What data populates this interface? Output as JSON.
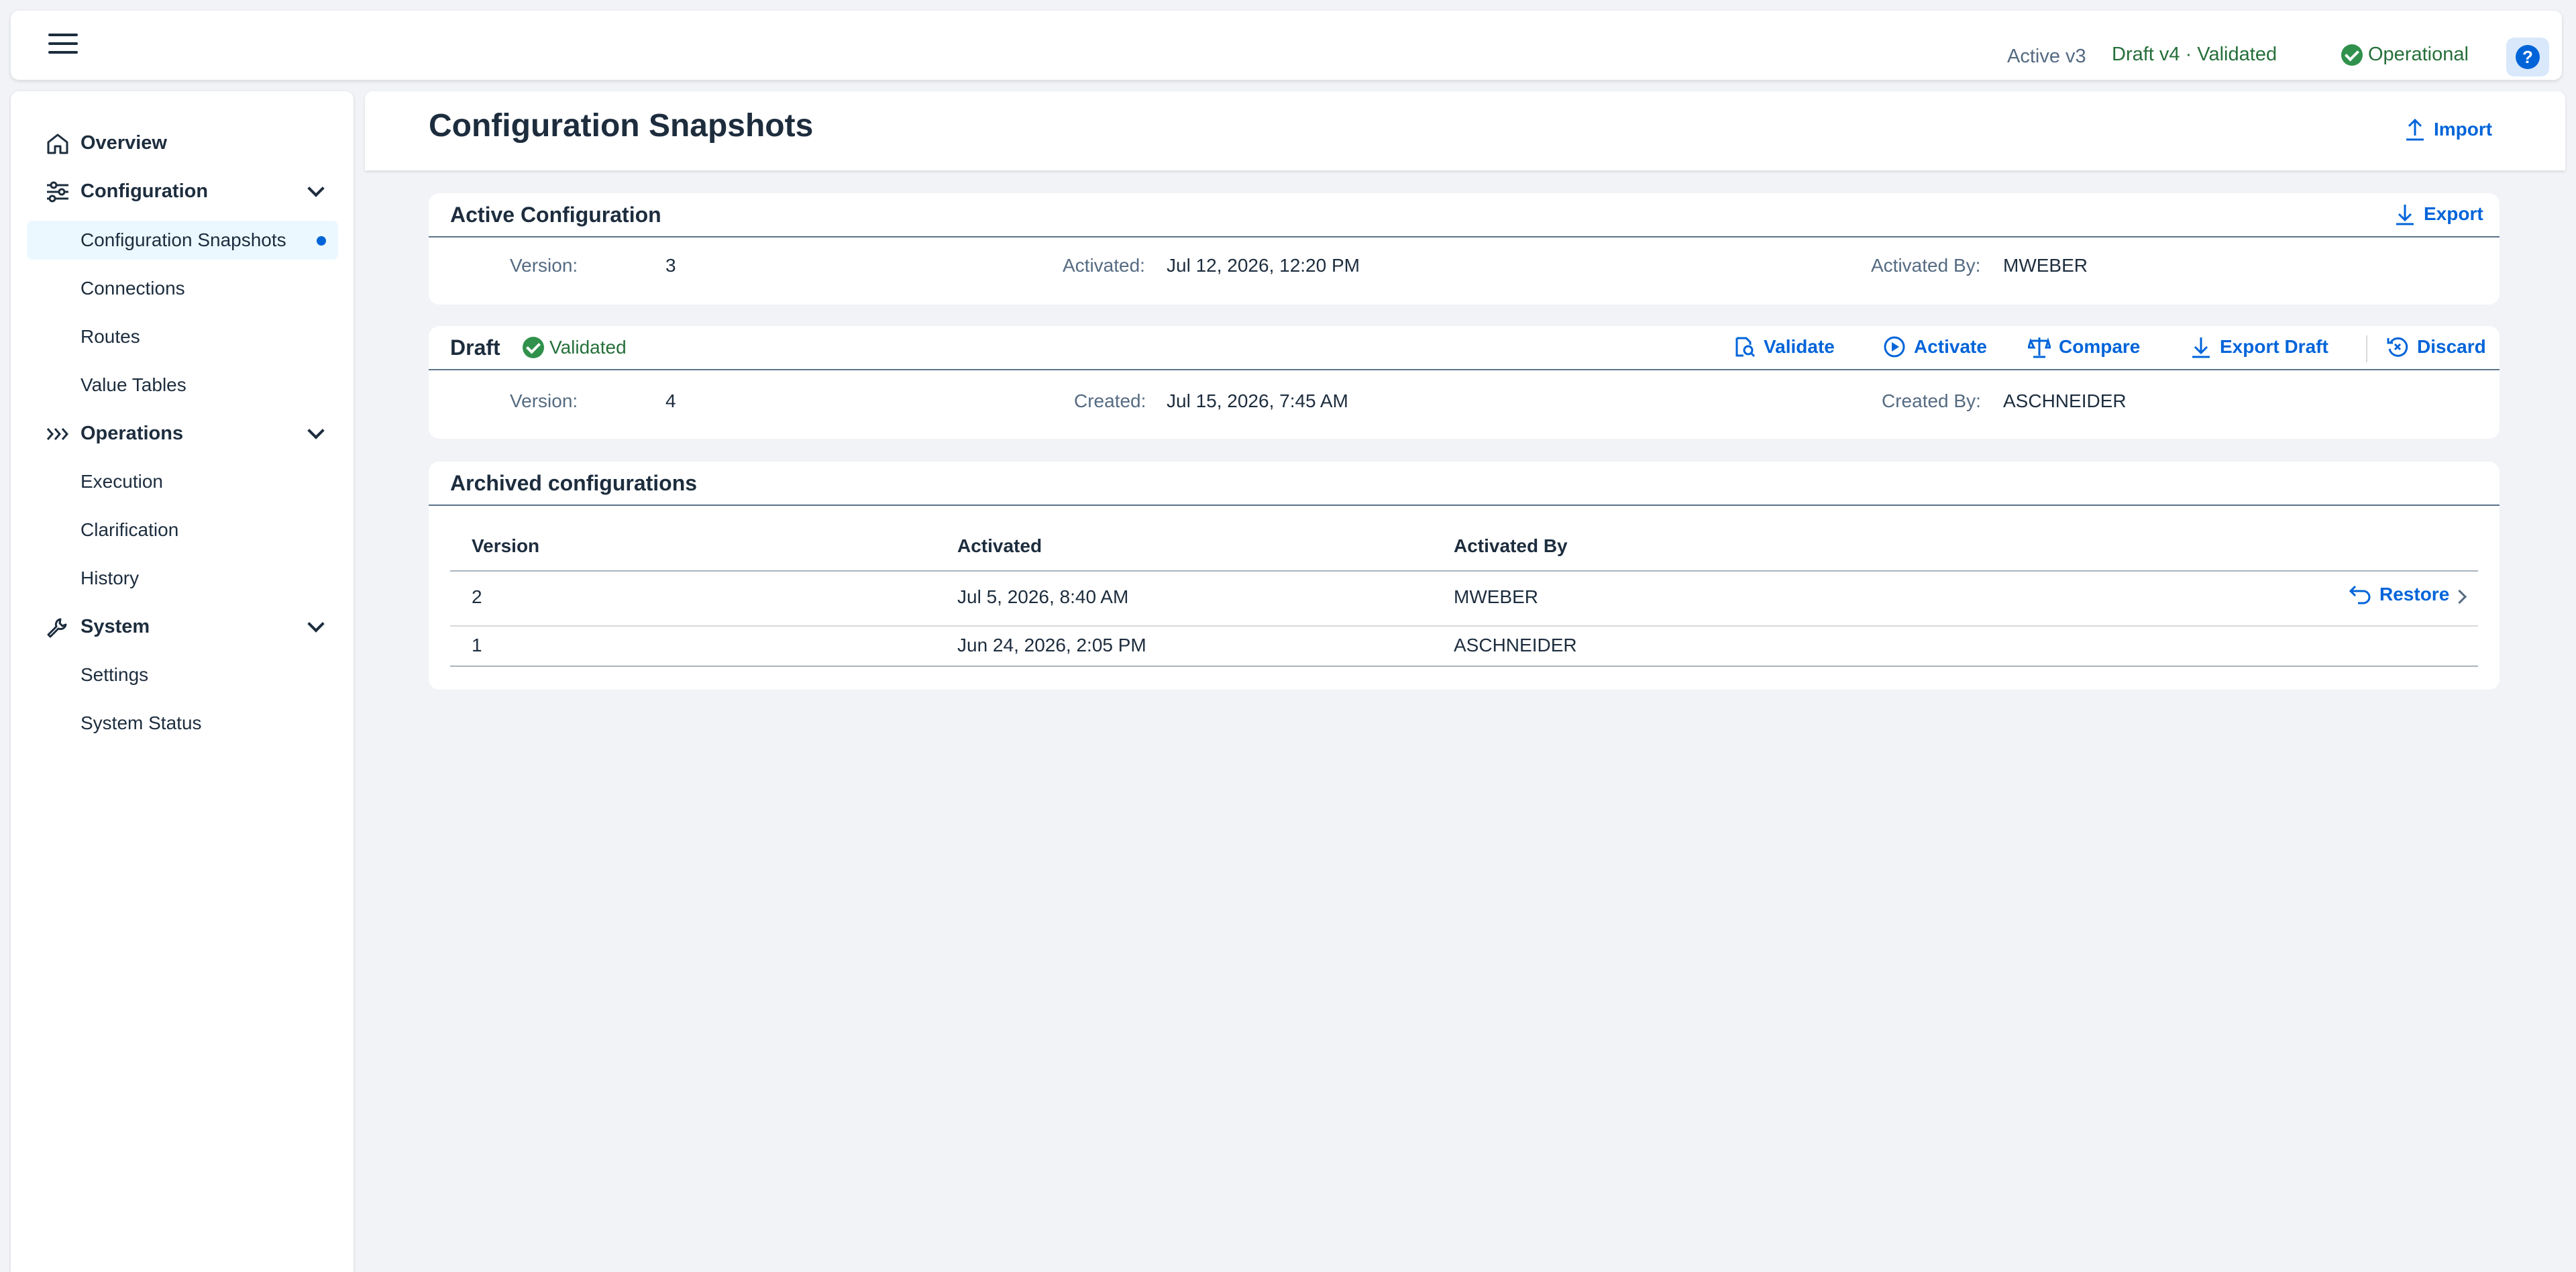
{
  "shellbar": {
    "active_label": "Active v3",
    "draft_label": "Draft v4 · Validated",
    "status_label": "Operational",
    "help_label": "?"
  },
  "sidebar": {
    "items": [
      {
        "label": "Overview",
        "icon": "home-icon"
      },
      {
        "label": "Configuration",
        "icon": "sliders-icon"
      },
      {
        "label": "Configuration Snapshots"
      },
      {
        "label": "Connections"
      },
      {
        "label": "Routes"
      },
      {
        "label": "Value Tables"
      },
      {
        "label": "Operations",
        "icon": "chevrons-right-icon"
      },
      {
        "label": "Execution"
      },
      {
        "label": "Clarification"
      },
      {
        "label": "History"
      },
      {
        "label": "System",
        "icon": "wrench-icon"
      },
      {
        "label": "Settings"
      },
      {
        "label": "System Status"
      }
    ]
  },
  "page": {
    "title": "Configuration Snapshots",
    "import_label": "Import"
  },
  "active": {
    "title": "Active Configuration",
    "export_label": "Export",
    "version_label": "Version:",
    "version": "3",
    "activated_label": "Activated:",
    "activated": "Jul 12, 2026, 12:20 PM",
    "activated_by_label": "Activated By:",
    "activated_by": "MWEBER"
  },
  "draft": {
    "title": "Draft",
    "status": "Validated",
    "actions": {
      "validate": "Validate",
      "activate": "Activate",
      "compare": "Compare",
      "export_draft": "Export Draft",
      "discard": "Discard"
    },
    "version_label": "Version:",
    "version": "4",
    "created_label": "Created:",
    "created": "Jul 15, 2026, 7:45 AM",
    "created_by_label": "Created By:",
    "created_by": "ASCHNEIDER"
  },
  "archived": {
    "title": "Archived configurations",
    "columns": [
      "Version",
      "Activated",
      "Activated By"
    ],
    "rows": [
      {
        "version": "2",
        "activated": "Jul 5, 2026, 8:40 AM",
        "activated_by": "MWEBER",
        "action": "Restore"
      },
      {
        "version": "1",
        "activated": "Jun 24, 2026, 2:05 PM",
        "activated_by": "ASCHNEIDER"
      }
    ]
  },
  "colors": {
    "accent": "#0064d9",
    "positive": "#256f3a",
    "positive_icon": "#30914c",
    "background": "#f1f3f6"
  }
}
